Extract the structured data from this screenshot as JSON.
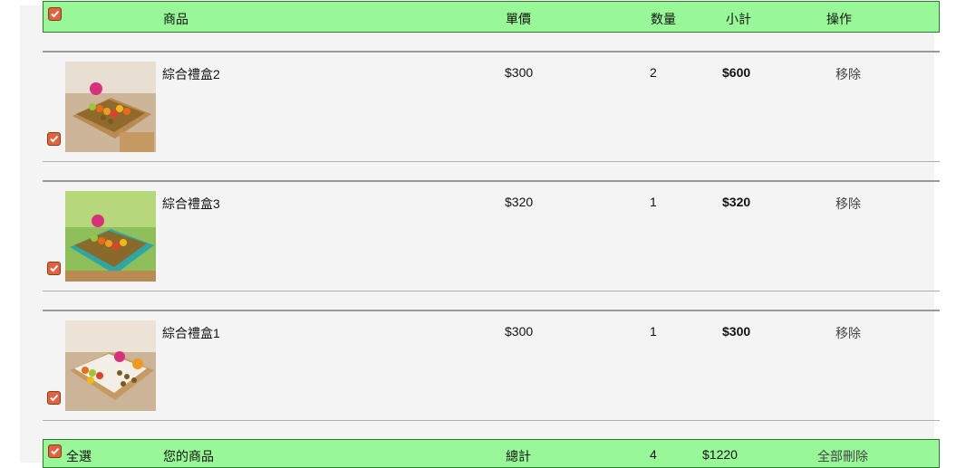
{
  "header": {
    "product": "商品",
    "unit_price": "單價",
    "quantity": "数量",
    "subtotal": "小計",
    "action": "操作"
  },
  "items": [
    {
      "name": "綜合禮盒2",
      "price": "$300",
      "qty": "2",
      "subtotal": "$600",
      "remove": "移除"
    },
    {
      "name": "綜合禮盒3",
      "price": "$320",
      "qty": "1",
      "subtotal": "$320",
      "remove": "移除"
    },
    {
      "name": "綜合禮盒1",
      "price": "$300",
      "qty": "1",
      "subtotal": "$300",
      "remove": "移除"
    }
  ],
  "footer": {
    "select_all": "全選",
    "your_items": "您的商品",
    "total_label": "總計",
    "total_qty": "4",
    "total_amount": "$1220",
    "delete_all": "全部刪除"
  },
  "colors": {
    "bar_bg": "#98f898",
    "checkbox": "#e2623c"
  }
}
